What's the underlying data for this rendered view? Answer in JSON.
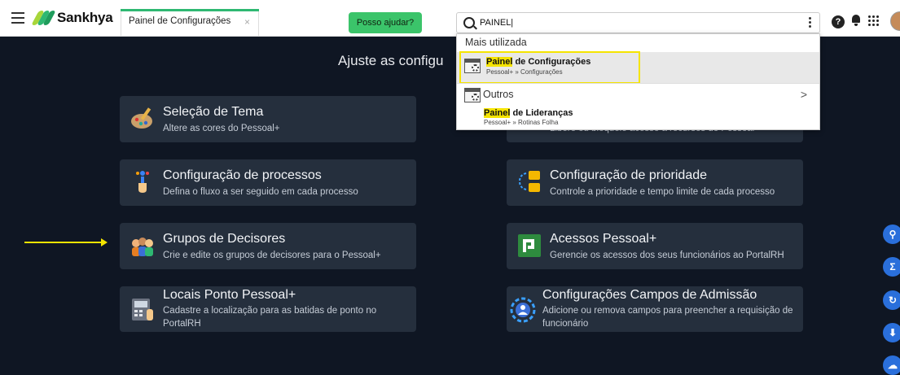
{
  "app": {
    "name": "Sankhya"
  },
  "tab": {
    "label": "Painel de Configurações",
    "close": "×"
  },
  "help_button": {
    "label": "Posso ajudar?"
  },
  "search": {
    "value": "PAINEL|",
    "placeholder": ""
  },
  "topbar_icons": {
    "help": "?"
  },
  "heading": "Ajuste as configu",
  "dropdown": {
    "section_label": "Mais utilizada",
    "top_item": {
      "title_mark": "Painel",
      "title_rest": " de Configurações",
      "path": "Pessoal+ » Configurações"
    },
    "others_label": "Outros",
    "chevron": ">",
    "other_item": {
      "title_mark": "Painel",
      "title_rest": " de Lideranças",
      "path": "Pessoal+ » Rotinas Folha"
    }
  },
  "cards": [
    {
      "title": "Seleção de Tema",
      "desc": "Altere as cores do Pessoal+",
      "icon": "palette-icon"
    },
    {
      "title": "Configuração de processos",
      "desc": "Defina o fluxo a ser seguido em cada processo",
      "icon": "process-icon"
    },
    {
      "title": "Configuração de prioridade",
      "desc": "Controle a prioridade e tempo limite de cada processo",
      "icon": "priority-icon"
    },
    {
      "title": "Grupos de Decisores",
      "desc": "Crie e edite os grupos de decisores para o Pessoal+",
      "icon": "group-icon"
    },
    {
      "title": "Acessos Pessoal+",
      "desc": "Gerencie os acessos dos seus funcionários ao PortalRH",
      "icon": "access-icon"
    },
    {
      "title": "Locais Ponto Pessoal+",
      "desc": "Cadastre a localização para as batidas de ponto no PortalRH",
      "icon": "time-clock-icon"
    },
    {
      "title": "Configurações Campos de Admissão",
      "desc": "Adicione ou remova campos para preencher a requisição de funcionário",
      "icon": "admission-icon"
    }
  ],
  "hidden_card_desc": "Libere ou bloqueie acesso a recursos do Pessoal+",
  "colors": {
    "accent": "#2eb872",
    "highlight": "#f5e400",
    "background": "#0f1623",
    "card": "#252f3d",
    "fab": "#2a6fdb"
  }
}
